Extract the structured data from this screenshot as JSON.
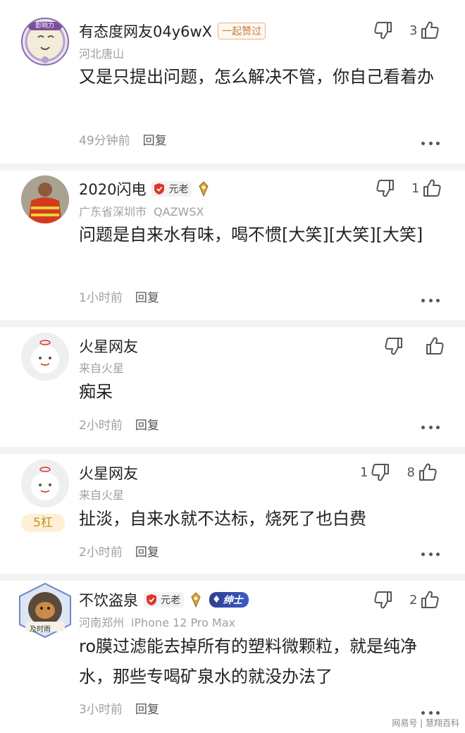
{
  "comments": [
    {
      "username": "有态度网友04y6wX",
      "badge": "一起赞过",
      "location": "河北唐山",
      "text": "又是只提出问题，怎么解决不管，你自己看着办",
      "time": "49分钟前",
      "reply": "回复",
      "dislikes": "",
      "likes": "3"
    },
    {
      "username": "2020闪电",
      "badge": "元老",
      "location": "广东省深圳市",
      "device": "QAZWSX",
      "text": "问题是自来水有味，喝不惯[大笑][大笑][大笑]",
      "time": "1小时前",
      "reply": "回复",
      "dislikes": "",
      "likes": "1"
    },
    {
      "username": "火星网友",
      "location": "来自火星",
      "text": "痴呆",
      "time": "2小时前",
      "reply": "回复",
      "dislikes": "",
      "likes": ""
    },
    {
      "username": "火星网友",
      "location": "来自火星",
      "rank": "5杠",
      "text": "扯淡，自来水就不达标，烧死了也白费",
      "time": "2小时前",
      "reply": "回复",
      "dislikes": "1",
      "likes": "8"
    },
    {
      "username": "不饮盗泉",
      "badge": "元老",
      "badge2": "绅士",
      "location": "河南郑州",
      "device": "iPhone 12 Pro Max",
      "text": "ro膜过滤能去掉所有的塑料微颗粒，就是纯净水，那些专喝矿泉水的就没办法了",
      "time": "3小时前",
      "reply": "回复",
      "dislikes": "",
      "likes": "2"
    }
  ],
  "avatar_labels": [
    "影响力",
    "及时雨"
  ],
  "watermark": "网易号 | 慧翔百科",
  "colors": {
    "background": "#ffffff",
    "divider": "#f3f3f3",
    "meta": "#a0a0a0",
    "zan_badge": "#c57a3e",
    "shield": "#e0352b"
  }
}
